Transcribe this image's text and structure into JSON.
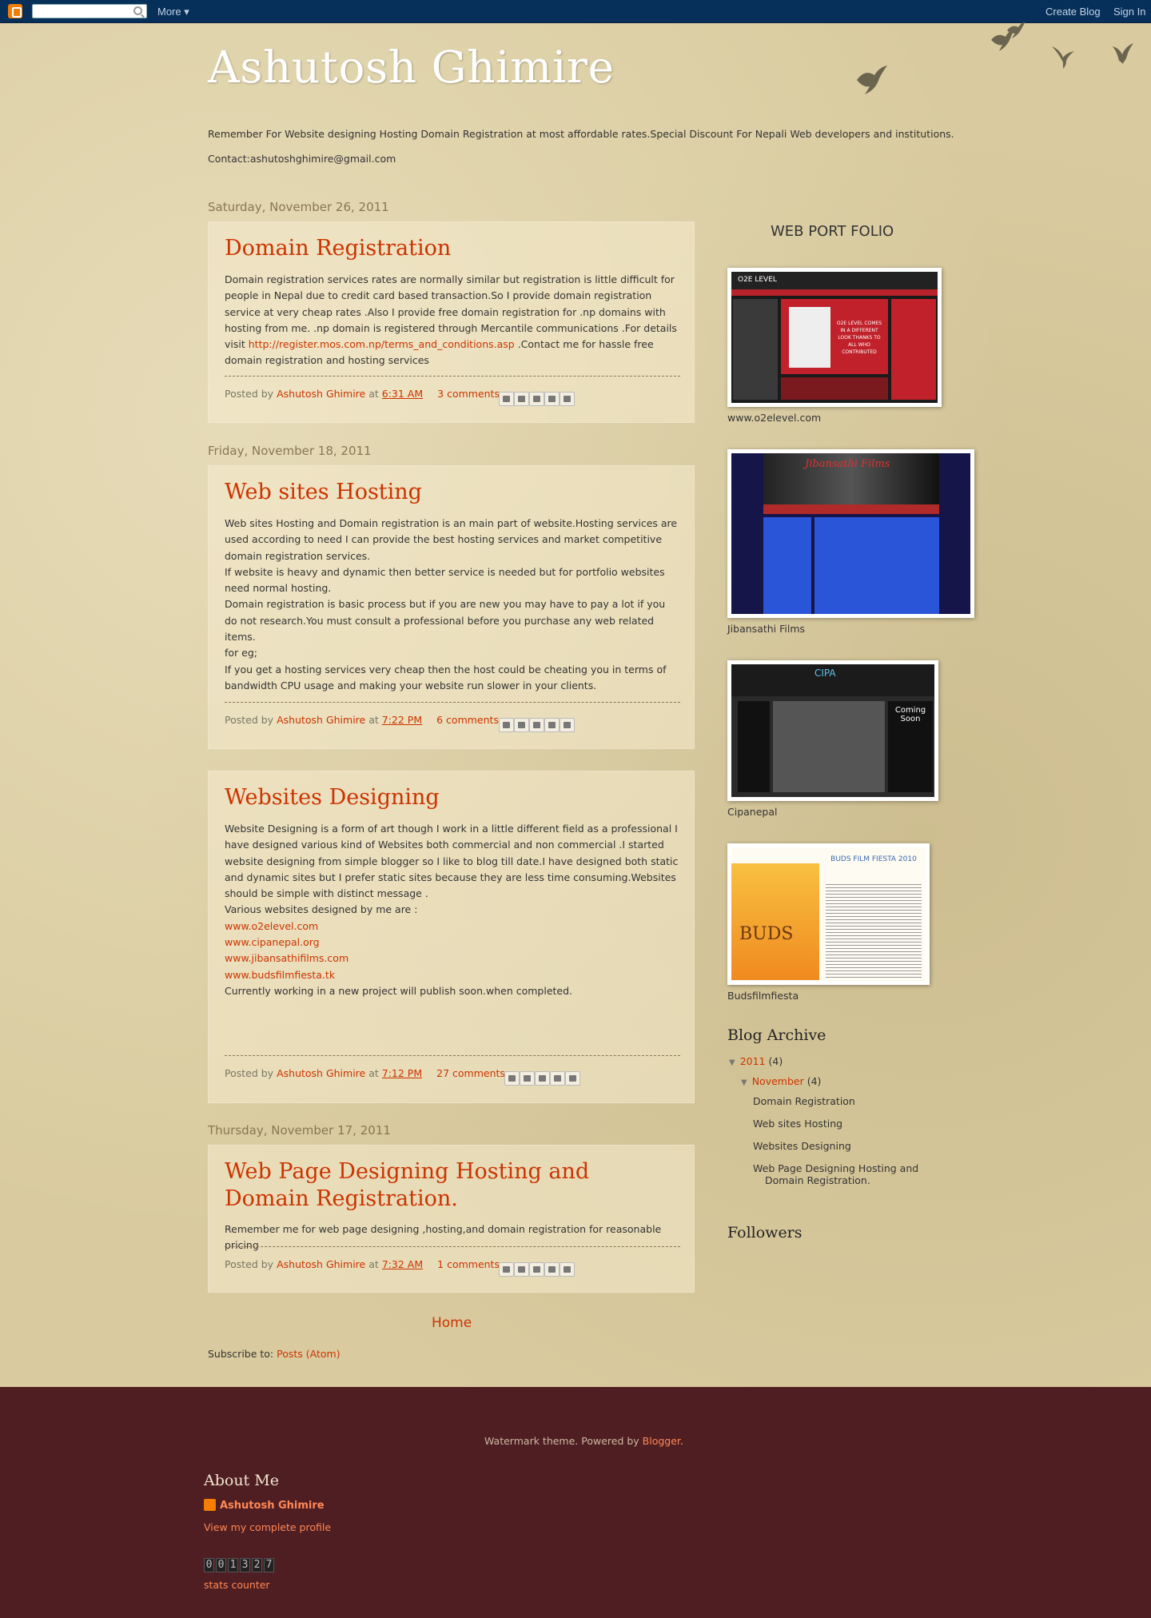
{
  "navbar": {
    "search_placeholder": "",
    "more_label": "More ▾",
    "create_blog_label": "Create Blog",
    "sign_in_label": "Sign In"
  },
  "header": {
    "title": "Ashutosh Ghimire",
    "description": "Remember For Website designing Hosting Domain Registration at most affordable rates.Special Discount For Nepali Web developers and institutions.",
    "contact": "Contact:ashutoshghimire@gmail.com"
  },
  "posts": [
    {
      "date": "Saturday, November 26, 2011",
      "title": "Domain Registration",
      "body_1": "Domain registration services rates are normally similar but registration is little difficult for people in Nepal due to credit card based transaction.So I provide domain registration service at very cheap rates .Also I provide free domain registration for .np domains with hosting from me. .np domain is registered through Mercantile communications .For details visit ",
      "body_link": "http://register.mos.com.np/terms_and_conditions.asp",
      "body_2": " .Contact me for hassle free domain registration and hosting services",
      "posted_by": "Posted by",
      "author": "Ashutosh Ghimire",
      "at": "at",
      "time": "6:31 AM",
      "comments": "3 comments"
    },
    {
      "date": "Friday, November 18, 2011",
      "title": "Web sites Hosting",
      "lines": [
        "Web sites Hosting and Domain registration is an main part of website.Hosting services are used according to need I can provide the best hosting services and market competitive domain registration services.",
        "If website is heavy and dynamic then better service is needed but for portfolio websites need normal hosting.",
        "Domain registration is basic process but if you are new you may have to pay a lot if you do not research.You must consult a professional before you purchase any web related items.",
        "for eg;",
        "If you get a hosting services very cheap then the host could be cheating you in terms of bandwidth CPU usage and making your website run slower in your clients."
      ],
      "posted_by": "Posted by",
      "author": "Ashutosh Ghimire",
      "at": "at",
      "time": "7:22 PM",
      "comments": "6 comments"
    },
    {
      "title": "Websites Designing",
      "intro": "Website Designing is a form of art though I work in a little different field as a professional I have designed various kind of Websites both commercial and non commercial .I started website designing from simple blogger so I like to blog till date.I have designed both static and dynamic sites but I prefer static sites because they are less time consuming.Websites should be simple with distinct message .",
      "list_intro": "Various websites designed by me are :",
      "links": [
        "www.o2elevel.com",
        "www.cipanepal.org",
        "www.jibansathifilms.com",
        "www.budsfilmfiesta.tk"
      ],
      "outro": "Currently working in a new project will publish soon.when completed.",
      "posted_by": "Posted by",
      "author": "Ashutosh Ghimire",
      "at": "at",
      "time": "7:12 PM",
      "comments": "27 comments"
    },
    {
      "date": "Thursday, November 17, 2011",
      "title": "Web Page Designing Hosting and Domain Registration.",
      "body": "Remember me for web page designing ,hosting,and domain registration for reasonable pricing",
      "posted_by": "Posted by",
      "author": "Ashutosh Ghimire",
      "at": "at",
      "time": "7:32 AM",
      "comments": "1 comments"
    }
  ],
  "share_icons": [
    "email-icon",
    "blogthis-icon",
    "twitter-icon",
    "facebook-icon",
    "pinterest-icon"
  ],
  "sidebar": {
    "portfolio_heading": "WEB PORT FOLIO",
    "portfolio": [
      {
        "caption": "www.o2elevel.com",
        "screen_text": "O2E LEVEL",
        "screen_sub": "O2E LEVEL COMES IN A DIFFERENT LOOK THANKS TO ALL WHO CONTRIBUTED"
      },
      {
        "caption": "Jibansathi Films",
        "screen_text": "Jibansathi Films"
      },
      {
        "caption": "Cipanepal",
        "screen_text": "CIPA",
        "screen_sub": "Coming Soon"
      },
      {
        "caption": "Budsfilmfiesta",
        "screen_text": "BUDS",
        "screen_sub": "BUDS FILM FIESTA 2010"
      }
    ],
    "archive_title": "Blog Archive",
    "archive_year": "2011",
    "archive_year_count": "(4)",
    "archive_month": "November",
    "archive_month_count": "(4)",
    "archive_posts": [
      "Domain Registration",
      "Web sites Hosting",
      "Websites Designing",
      "Web Page Designing Hosting and",
      "Domain Registration."
    ],
    "followers_title": "Followers"
  },
  "footer_nav": {
    "home": "Home",
    "subscribe_label": "Subscribe to:",
    "subscribe_link": "Posts (Atom)"
  },
  "footer": {
    "powered_1": "Watermark theme. Powered by ",
    "powered_link": "Blogger",
    "powered_2": ".",
    "about_title": "About Me",
    "profile_name": "Ashutosh Ghimire",
    "view_profile": "View my complete profile",
    "counter_digits": [
      "0",
      "0",
      "1",
      "3",
      "2",
      "7"
    ],
    "stats_counter": "stats counter"
  },
  "colors": {
    "link": "#cc3300",
    "navbar_bg": "#06305a",
    "footer_bg": "#4f1e22",
    "page_bg": "#d9cb9f"
  }
}
